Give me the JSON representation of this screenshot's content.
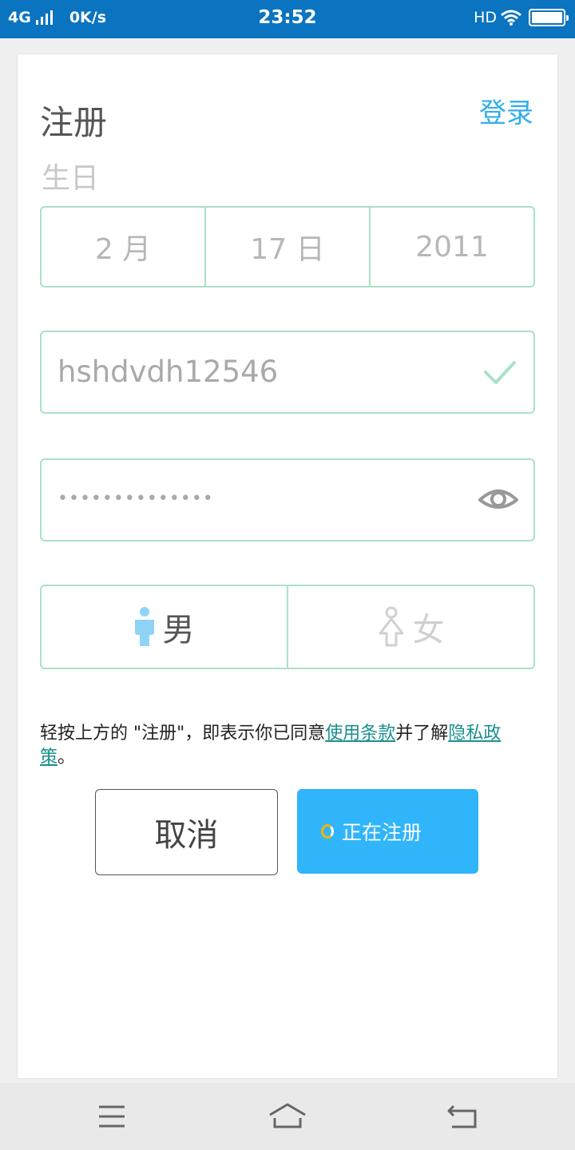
{
  "status_bar": {
    "network": "4G",
    "speed": "0K/s",
    "time": "23:52",
    "hd": "HD",
    "icons": [
      "signal-icon",
      "wifi-icon",
      "battery-icon"
    ]
  },
  "header": {
    "title": "注册",
    "login_link": "登录"
  },
  "birthday": {
    "label": "生日",
    "month": "2 月",
    "day": "17 日",
    "year": "2011"
  },
  "username": {
    "value": "hshdvdh12546"
  },
  "password": {
    "value": "••••••••••••••"
  },
  "gender": {
    "male": "男",
    "female": "女",
    "selected": "male"
  },
  "terms": {
    "prefix": "轻按上方的 \"注册\"，即表示你已同意",
    "terms_link": "使用条款",
    "middle": "并了解",
    "privacy_link": "隐私政策",
    "suffix": "。"
  },
  "buttons": {
    "cancel": "取消",
    "register": "正在注册"
  },
  "colors": {
    "status_bar": "#0a74c0",
    "accent": "#33aee8",
    "field_border": "#a9e2c5",
    "register_button": "#30b5fa",
    "link": "#1a8f8f"
  }
}
